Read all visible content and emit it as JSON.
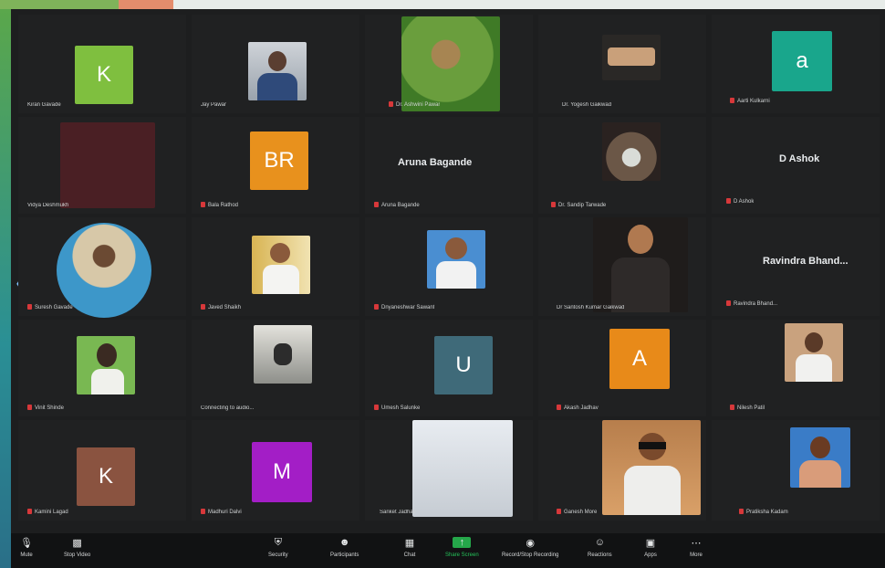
{
  "meeting": {
    "participants": [
      {
        "name": "Kiran Gavade",
        "initial": "K",
        "color": "#7fbf3f"
      },
      {
        "name": "Jay Pawar",
        "initial": "",
        "color": "#6e7d8f"
      },
      {
        "name": "Dr. Ashwini Pawar",
        "initial": "",
        "color": "#5e8f3c"
      },
      {
        "name": "Dr. Yogesh Gaikwad",
        "initial": "",
        "color": "#8a6b55"
      },
      {
        "name": "Aarti Kulkarni",
        "initial": "a",
        "color": "#19a68c"
      },
      {
        "name": "Vidya Deshmukh",
        "initial": "",
        "color": "#4a1f24"
      },
      {
        "name": "Bala Rathod",
        "initial": "BR",
        "color": "#e8911d"
      },
      {
        "name": "Aruna Bagande",
        "initial": "",
        "color": "",
        "text": "Aruna Bagande"
      },
      {
        "name": "Dr. Sandip Tarwade",
        "initial": "",
        "color": "#7b6a5a"
      },
      {
        "name": "D Ashok",
        "initial": "",
        "color": "",
        "text": "D Ashok"
      },
      {
        "name": "Suresh Gavade",
        "initial": "",
        "color": "#3d97c9"
      },
      {
        "name": "Javed Shaikh",
        "initial": "",
        "color": "#d8b453"
      },
      {
        "name": "Dnyaneshwar Sawant",
        "initial": "",
        "color": "#4a8ed1"
      },
      {
        "name": "Dr Santosh Kumar Gaikwad",
        "initial": "",
        "color": "#2a2625"
      },
      {
        "name": "Ravindra Bhand...",
        "initial": "",
        "color": "",
        "text": "Ravindra  Bhand..."
      },
      {
        "name": "Vinit Shinde",
        "initial": "",
        "color": "#79b852"
      },
      {
        "name": "Connecting to audio...",
        "initial": "",
        "color": "#b7b8b3"
      },
      {
        "name": "Umesh Salunke",
        "initial": "U",
        "color": "#3f6a79"
      },
      {
        "name": "Akash Jadhav",
        "initial": "A",
        "color": "#e88a19"
      },
      {
        "name": "Nilesh Patil",
        "initial": "",
        "color": "#c9a27e"
      },
      {
        "name": "Kamini Lagad",
        "initial": "K",
        "color": "#8a5340"
      },
      {
        "name": "Madhuri Dalvi",
        "initial": "M",
        "color": "#a31ec6"
      },
      {
        "name": "Sanket Jadhav",
        "initial": "",
        "color": "#d9dbdf"
      },
      {
        "name": "Ganesh More",
        "initial": "",
        "color": "#b77e4c"
      },
      {
        "name": "Pratiksha Kadam",
        "initial": "",
        "color": "#3a7cc7"
      }
    ]
  },
  "toolbar": {
    "items": [
      {
        "label": "Mute",
        "icon": "mic-icon"
      },
      {
        "label": "Stop Video",
        "icon": "video-icon"
      },
      {
        "label": "Security",
        "icon": "shield-icon"
      },
      {
        "label": "Participants",
        "icon": "participants-icon"
      },
      {
        "label": "Chat",
        "icon": "chat-icon"
      },
      {
        "label": "Share Screen",
        "icon": "share-screen-icon"
      },
      {
        "label": "Record/Stop Recording",
        "icon": "record-icon"
      },
      {
        "label": "Reactions",
        "icon": "reactions-icon"
      },
      {
        "label": "Apps",
        "icon": "apps-icon"
      },
      {
        "label": "More",
        "icon": "more-icon"
      }
    ]
  }
}
